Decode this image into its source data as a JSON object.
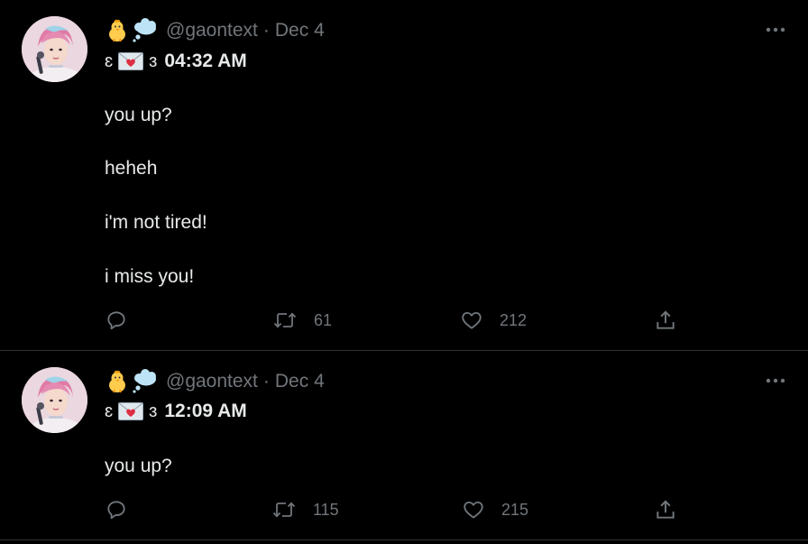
{
  "tweets": [
    {
      "handle": "@gaontext",
      "separator": "·",
      "date": "Dec 4",
      "name_left": "ɛ",
      "name_right": "ɜ",
      "name_time": "04:32 AM",
      "lines": [
        "you up?",
        "heheh",
        "i'm not tired!",
        "i miss you!"
      ],
      "retweets": "61",
      "likes": "212"
    },
    {
      "handle": "@gaontext",
      "separator": "·",
      "date": "Dec 4",
      "name_left": "ɛ",
      "name_right": "ɜ",
      "name_time": "12:09 AM",
      "lines": [
        "you up?"
      ],
      "retweets": "115",
      "likes": "215"
    }
  ],
  "icons": {
    "reply": "reply-icon",
    "retweet": "retweet-icon",
    "like": "heart-icon",
    "share": "share-icon",
    "more": "more-icon",
    "chick": "baby-chick-icon",
    "thought": "thought-balloon-icon",
    "envelope": "love-letter-icon"
  },
  "colors": {
    "background": "#000000",
    "text": "#e7e9ea",
    "muted": "#71767b",
    "divider": "#2f3336"
  }
}
